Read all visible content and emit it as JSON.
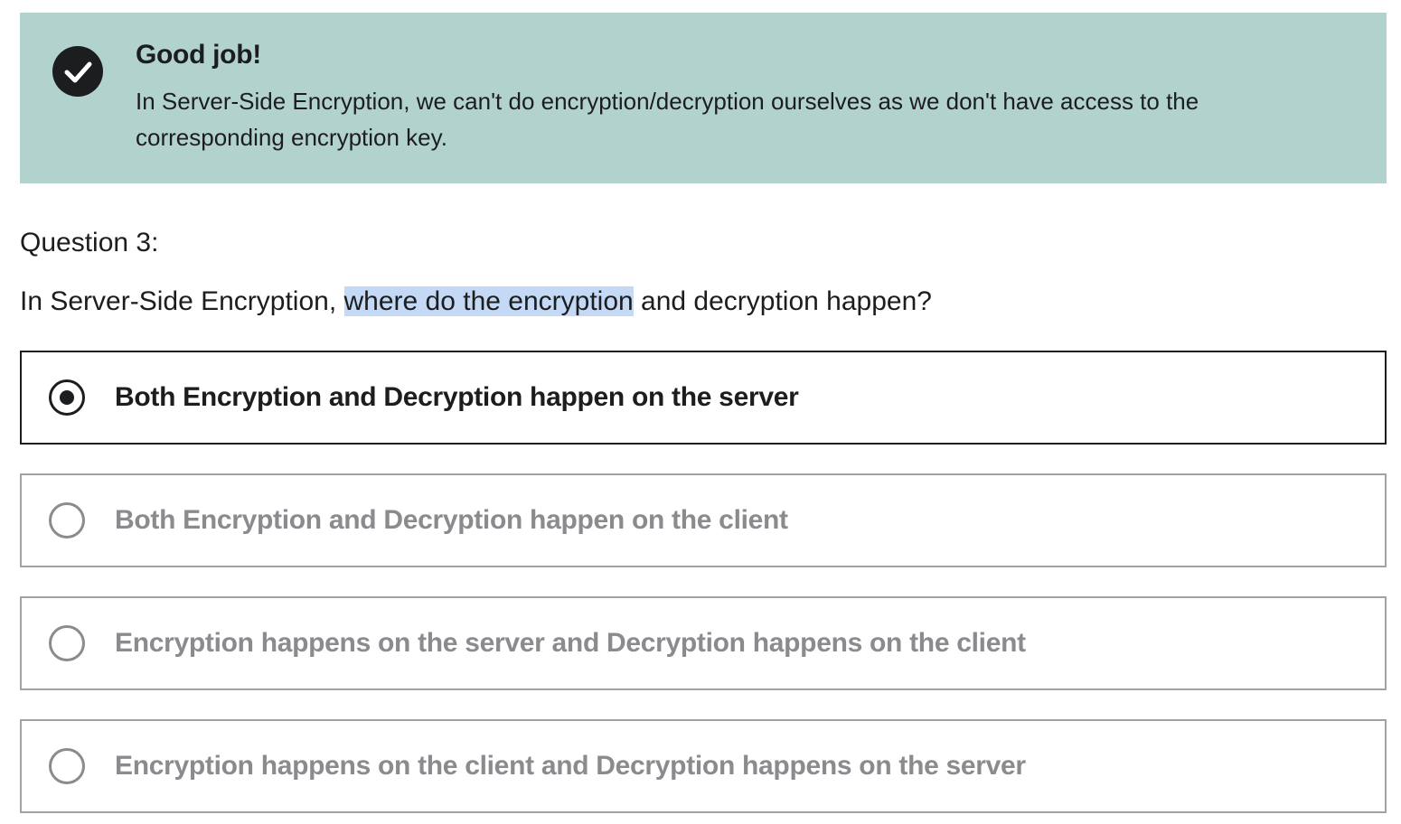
{
  "feedback": {
    "icon": "check-circle-icon",
    "title": "Good job!",
    "message": "In Server-Side Encryption, we can't do encryption/decryption ourselves as we don't have access to the corresponding encryption key.",
    "background_color": "#b2d3cd"
  },
  "question": {
    "number_label": "Question 3:",
    "text_before": "In Server-Side Encryption, ",
    "text_highlighted": "where do the encryption",
    "text_after": " and decryption happen?",
    "highlight_color": "#c3d9f5"
  },
  "answers": [
    {
      "label": "Both Encryption and Decryption happen on the server",
      "selected": true
    },
    {
      "label": "Both Encryption and Decryption happen on the client",
      "selected": false
    },
    {
      "label": "Encryption happens on the server and Decryption happens on the client",
      "selected": false
    },
    {
      "label": "Encryption happens on the client and Decryption happens on the server",
      "selected": false
    }
  ]
}
